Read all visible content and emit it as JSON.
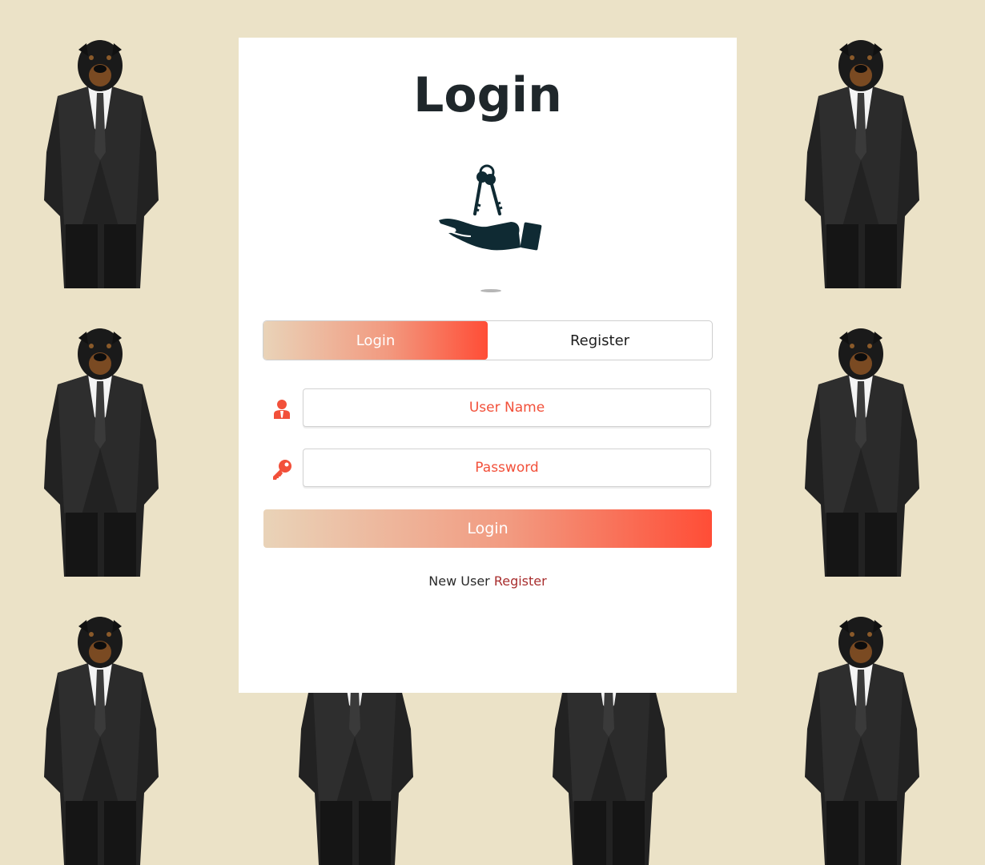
{
  "page": {
    "title": "Login"
  },
  "tabs": [
    {
      "label": "Login",
      "active": true
    },
    {
      "label": "Register",
      "active": false
    }
  ],
  "form": {
    "username_placeholder": "User Name",
    "password_placeholder": "Password",
    "submit_label": "Login"
  },
  "footer": {
    "prompt": "New User",
    "link_label": "Register"
  },
  "icons": {
    "logo": "hand-with-keys-icon",
    "username": "user-icon",
    "password": "key-icon"
  },
  "colors": {
    "background": "#ebe2c7",
    "accent": "#ff4d36",
    "gradient_start": "#e9d3b8",
    "title": "#1f272b",
    "link": "#a82e2e"
  }
}
